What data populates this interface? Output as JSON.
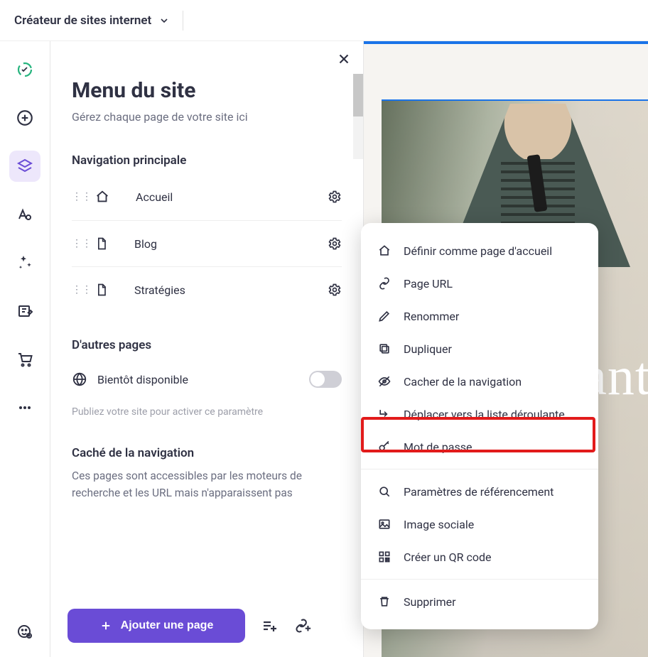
{
  "topbar": {
    "title": "Créateur de sites internet"
  },
  "panel": {
    "title": "Menu du site",
    "subtitle": "Gérez chaque page de votre site ici",
    "nav_section_title": "Navigation principale",
    "pages": [
      {
        "label": "Accueil"
      },
      {
        "label": "Blog"
      },
      {
        "label": "Stratégies"
      }
    ],
    "other_section_title": "D'autres pages",
    "other_toggle_label": "Bientôt disponible",
    "publish_hint": "Publiez votre site pour activer ce paramètre",
    "hidden_section_title": "Caché de la navigation",
    "hidden_desc": "Ces pages sont accessibles par les moteurs de recherche et les URL mais n'apparaissent pas",
    "add_page_label": "Ajouter une page"
  },
  "canvas": {
    "hero_fragment": "ant"
  },
  "context_menu": {
    "items": [
      {
        "label": "Définir comme page d'accueil",
        "icon": "home"
      },
      {
        "label": "Page URL",
        "icon": "link"
      },
      {
        "label": "Renommer",
        "icon": "pen"
      },
      {
        "label": "Dupliquer",
        "icon": "copy"
      },
      {
        "label": "Cacher de la navigation",
        "icon": "eye-off"
      },
      {
        "label": "Déplacer vers la liste déroulante",
        "icon": "subdir",
        "highlight": true
      },
      {
        "label": "Mot de passe",
        "icon": "key"
      }
    ],
    "items2": [
      {
        "label": "Paramètres de référencement",
        "icon": "search"
      },
      {
        "label": "Image sociale",
        "icon": "image"
      },
      {
        "label": "Créer un QR code",
        "icon": "qr"
      }
    ],
    "items3": [
      {
        "label": "Supprimer",
        "icon": "trash"
      }
    ]
  }
}
